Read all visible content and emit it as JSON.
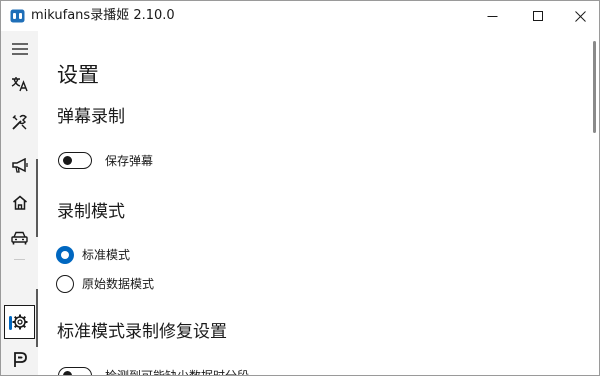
{
  "window": {
    "title": "mikufans录播姬 2.10.0"
  },
  "nav": {
    "items": [
      {
        "name": "menu",
        "icon": "hamburger-menu-icon"
      },
      {
        "name": "translate",
        "icon": "translate-icon"
      },
      {
        "name": "tools",
        "icon": "tools-icon"
      },
      {
        "name": "announcements",
        "icon": "megaphone-icon"
      },
      {
        "name": "home",
        "icon": "home-icon"
      },
      {
        "name": "rooms",
        "icon": "car-icon"
      },
      {
        "name": "settings",
        "icon": "gear-icon",
        "selected": true
      },
      {
        "name": "about",
        "icon": "logo-p-icon"
      }
    ]
  },
  "settings": {
    "page_title": "设置",
    "danmaku": {
      "header": "弹幕录制",
      "save_label": "保存弹幕",
      "save_enabled": false
    },
    "record_mode": {
      "header": "录制模式",
      "options": [
        {
          "label": "标准模式",
          "checked": true
        },
        {
          "label": "原始数据模式",
          "checked": false
        }
      ]
    },
    "repair": {
      "header": "标准模式录制修复设置",
      "first_option_label": "检测到可能缺少数据时分段"
    }
  },
  "colors": {
    "accent": "#0067c0",
    "rail_background": "#f3f3f3"
  }
}
